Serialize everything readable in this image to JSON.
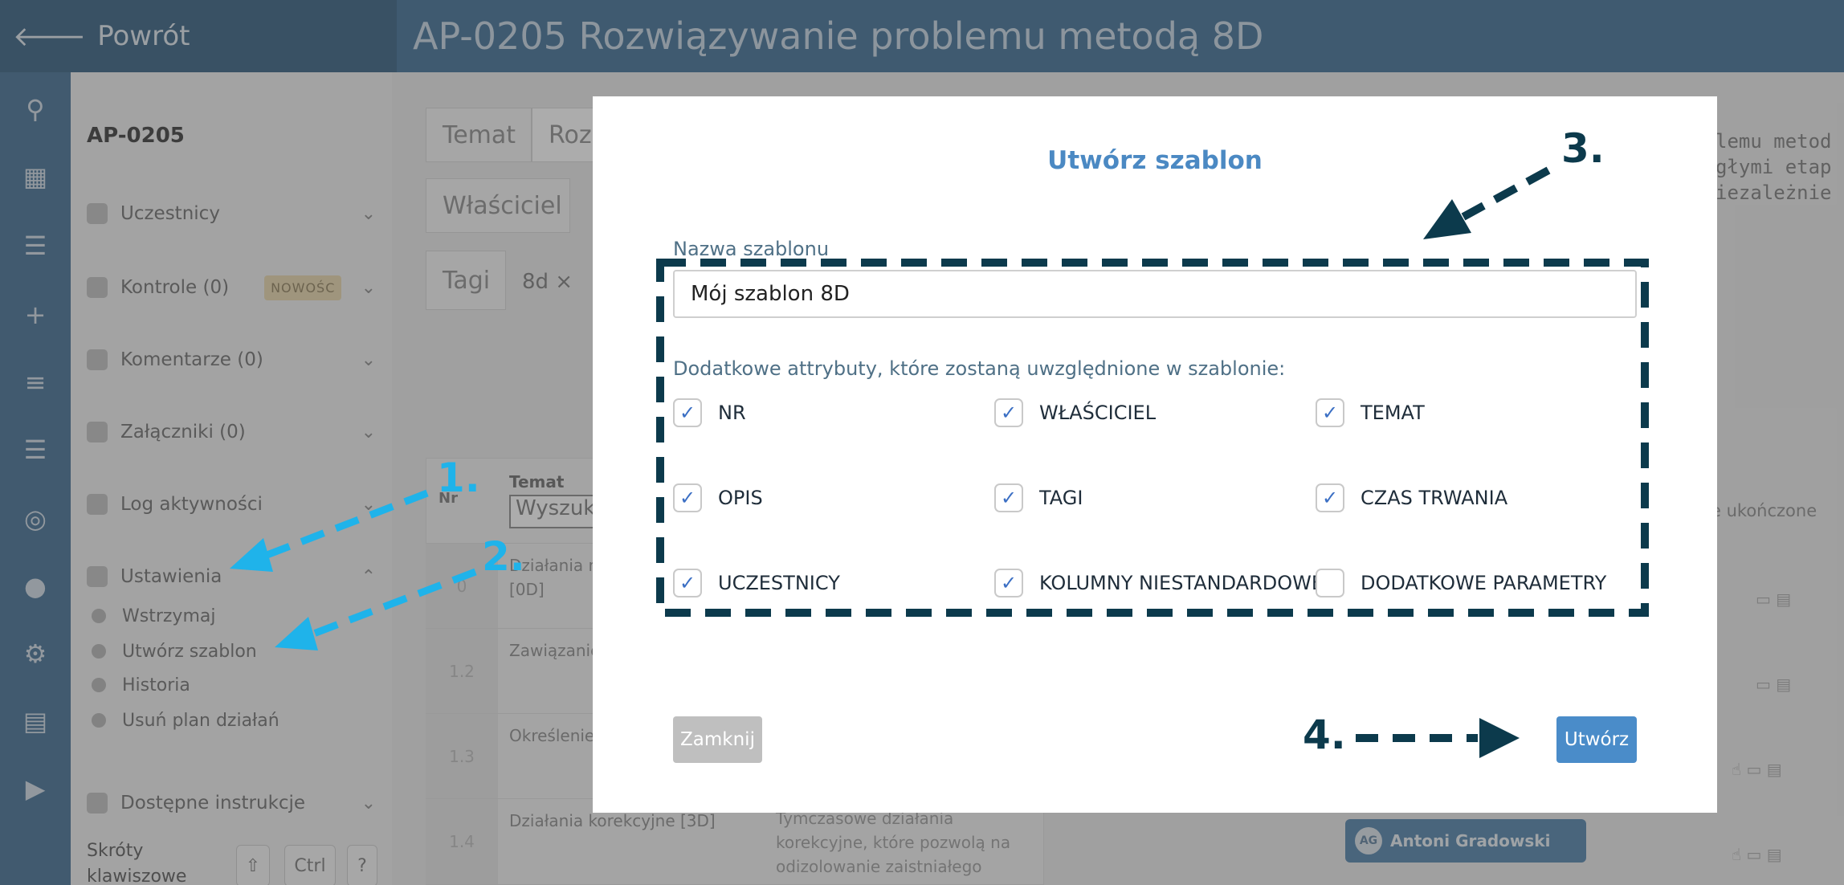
{
  "header": {
    "back_label": "Powrót",
    "title": "AP-0205 Rozwiązywanie problemu metodą 8D"
  },
  "left_panel": {
    "id": "AP-0205",
    "items": [
      {
        "label": "Uczestnicy"
      },
      {
        "label": "Kontrole (0)",
        "badge": "NOWOŚC"
      },
      {
        "label": "Komentarze (0)"
      },
      {
        "label": "Załączniki (0)"
      },
      {
        "label": "Log aktywności"
      },
      {
        "label": "Ustawienia"
      }
    ],
    "settings_subitems": [
      "Wstrzymaj",
      "Utwórz szablon",
      "Historia",
      "Usuń plan działań"
    ],
    "instructions_label": "Dostępne instrukcje",
    "shortcuts_label_1": "Skróty",
    "shortcuts_label_2": "klawiszowe",
    "keys": [
      "⇧",
      "Ctrl",
      "?"
    ]
  },
  "main": {
    "temat_label": "Temat",
    "temat_value": "Rozw",
    "owner_label": "Właściciel",
    "tags_label": "Tagi",
    "tag_chip": "8d ×",
    "table": {
      "col_nr": "Nr",
      "col_temat": "Temat",
      "search_placeholder": "Wyszuk",
      "rows": [
        {
          "nr": "0",
          "text_1": "Działania n",
          "text_2": "[0D]"
        },
        {
          "nr": "1.2",
          "text_1": "Zawiązanie",
          "text_2": ""
        },
        {
          "nr": "1.3",
          "text_1": "Określenie",
          "text_2": ""
        },
        {
          "nr": "1.4",
          "text_1": "Działania korekcyjne [3D]",
          "text_2": ""
        }
      ],
      "description_cell": "Tymczasowe działania korekcyjne, które pozwolą na odizolowanie zaistniałego"
    },
    "owner_chip": {
      "initials": "AG",
      "name": "Antoni Gradowski"
    },
    "right_code": "lemu metod\ngłymi etap\niezależnie",
    "right_done": "e ukończone"
  },
  "modal": {
    "title": "Utwórz szablon",
    "name_label": "Nazwa szablonu",
    "name_value": "Mój szablon 8D",
    "attributes_label": "Dodatkowe attrybuty, które zostaną uwzględnione w szablonie:",
    "attributes": [
      {
        "label": "NR",
        "checked": true
      },
      {
        "label": "WŁAŚCICIEL",
        "checked": true
      },
      {
        "label": "TEMAT",
        "checked": true
      },
      {
        "label": "OPIS",
        "checked": true
      },
      {
        "label": "TAGI",
        "checked": true
      },
      {
        "label": "CZAS TRWANIA",
        "checked": true
      },
      {
        "label": "UCZESTNICY",
        "checked": true
      },
      {
        "label": "KOLUMNY NIESTANDARDOWE",
        "checked": true
      },
      {
        "label": "DODATKOWE PARAMETRY",
        "checked": false
      }
    ],
    "close_label": "Zamknij",
    "create_label": "Utwórz"
  },
  "annotations": {
    "step1": "1.",
    "step2": "2.",
    "step3": "3.",
    "step4": "4.",
    "arrow_color_blue": "#1fb3ea",
    "arrow_color_dark": "#0c3a4c"
  },
  "colors": {
    "topbar": "#3a6b92",
    "modal_title": "#4b89c3",
    "create_button": "#4a8cc9",
    "close_button": "#bfbfbf",
    "check": "#3b6fc4"
  }
}
